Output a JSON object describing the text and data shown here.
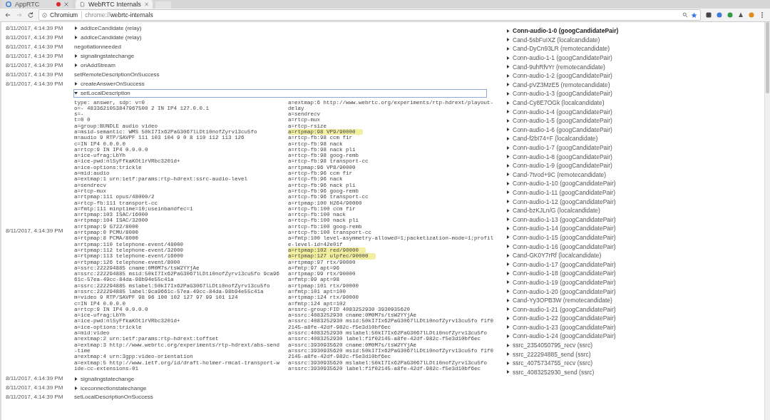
{
  "browser": {
    "tabs": [
      {
        "title": "AppRTC",
        "selected": false,
        "recording": true
      },
      {
        "title": "WebRTC Internals",
        "selected": true,
        "recording": false
      }
    ],
    "address": {
      "chip": "Chromium",
      "url_scheme": "chrome://",
      "url_path": "webrtc-internals"
    }
  },
  "events": [
    {
      "time": "8/11/2017, 4:14:39 PM",
      "kind": "details",
      "label": "addIceCandidate (relay)",
      "expanded": false
    },
    {
      "time": "8/11/2017, 4:14:39 PM",
      "kind": "details",
      "label": "addIceCandidate (relay)",
      "expanded": false
    },
    {
      "time": "8/11/2017, 4:14:39 PM",
      "kind": "plain",
      "label": "negotiationneeded"
    },
    {
      "time": "8/11/2017, 4:14:39 PM",
      "kind": "details",
      "label": "signalingstatechange",
      "expanded": false
    },
    {
      "time": "8/11/2017, 4:14:39 PM",
      "kind": "details",
      "label": "onAddStream",
      "expanded": false
    },
    {
      "time": "8/11/2017, 4:14:39 PM",
      "kind": "plain",
      "label": "setRemoteDescriptionOnSuccess"
    },
    {
      "time": "8/11/2017, 4:14:39 PM",
      "kind": "details",
      "label": "createAnswerOnSuccess",
      "expanded": false
    },
    {
      "time": "8/11/2017, 4:14:39 PM",
      "kind": "details",
      "label": "setLocalDescription",
      "expanded": true,
      "sdp": [
        {
          "text": "type: answer, sdp: v=0",
          "highlighted": false
        },
        {
          "text": "o=- 4833621053847967500 2 IN IP4 127.0.0.1",
          "highlighted": false
        },
        {
          "text": "s=-",
          "highlighted": false
        },
        {
          "text": "t=0 0",
          "highlighted": false
        },
        {
          "text": "a=group:BUNDLE audio video",
          "highlighted": false
        },
        {
          "text": "a=msid-semantic: WMS 50kI7Ix62PaG3067lLDti0nofZyrv13cu5fo",
          "highlighted": false
        },
        {
          "text": "m=audio 9 RTP/SAVPF 111 103 104 9 0 8 110 112 113 126",
          "highlighted": false
        },
        {
          "text": "c=IN IP4 0.0.0.0",
          "highlighted": false
        },
        {
          "text": "a=rtcp:9 IN IP4 0.0.0.0",
          "highlighted": false
        },
        {
          "text": "a=ice-ufrag:LbYh",
          "highlighted": false
        },
        {
          "text": "a=ice-pwd:nl5yFfkaKOt1rVRbc3201d+",
          "highlighted": false
        },
        {
          "text": "a=ice-options:trickle",
          "highlighted": false
        },
        {
          "text": "a=mid:audio",
          "highlighted": false
        },
        {
          "text": "a=extmap:1 urn:ietf:params:rtp-hdrext:ssrc-audio-level",
          "highlighted": false
        },
        {
          "text": "a=sendrecv",
          "highlighted": false
        },
        {
          "text": "a=rtcp-mux",
          "highlighted": false
        },
        {
          "text": "a=rtpmap:111 opus/48000/2",
          "highlighted": false
        },
        {
          "text": "a=rtcp-fb:111 transport-cc",
          "highlighted": false
        },
        {
          "text": "a=fmtp:111 minptime=10;useinbandfec=1",
          "highlighted": false
        },
        {
          "text": "a=rtpmap:103 ISAC/16000",
          "highlighted": false
        },
        {
          "text": "a=rtpmap:104 ISAC/32000",
          "highlighted": false
        },
        {
          "text": "a=rtpmap:9 G722/8000",
          "highlighted": false
        },
        {
          "text": "a=rtpmap:0 PCMU/8000",
          "highlighted": false
        },
        {
          "text": "a=rtpmap:8 PCMA/8000",
          "highlighted": false
        },
        {
          "text": "a=rtpmap:110 telephone-event/48000",
          "highlighted": false
        },
        {
          "text": "a=rtpmap:112 telephone-event/32000",
          "highlighted": false
        },
        {
          "text": "a=rtpmap:113 telephone-event/16000",
          "highlighted": false
        },
        {
          "text": "a=rtpmap:126 telephone-event/8000",
          "highlighted": false
        },
        {
          "text": "a=ssrc:222294885 cname:0M0M7s/tsW2YYjAe",
          "highlighted": false
        },
        {
          "text": "a=ssrc:222294885 msid:50kI7Ix62PaG3067lLDti0nofZyrv13cu5fo 9ca9661c-57ea-49cc-84da-98b94e55c41a",
          "highlighted": false
        },
        {
          "text": "a=ssrc:222294885 mslabel:50kI7Ix62PaG3067lLDti0nofZyrv13cu5fo",
          "highlighted": false
        },
        {
          "text": "a=ssrc:222294885 label:9ca9661c-57ea-49cc-84da-98b94e55c41a",
          "highlighted": false
        },
        {
          "text": "m=video 9 RTP/SAVPF 98 96 100 102 127 97 99 101 124",
          "highlighted": false
        },
        {
          "text": "c=IN IP4 0.0.0.0",
          "highlighted": false
        },
        {
          "text": "a=rtcp:9 IN IP4 0.0.0.0",
          "highlighted": false
        },
        {
          "text": "a=ice-ufrag:LbYh",
          "highlighted": false
        },
        {
          "text": "a=ice-pwd:nl5yFfkaKOt1rVRbc3201d+",
          "highlighted": false
        },
        {
          "text": "a=ice-options:trickle",
          "highlighted": false
        },
        {
          "text": "a=mid:video",
          "highlighted": false
        },
        {
          "text": "a=extmap:2 urn:ietf:params:rtp-hdrext:toffset",
          "highlighted": false
        },
        {
          "text": "a=extmap:3 http://www.webrtc.org/experiments/rtp-hdrext/abs-send-time",
          "highlighted": false
        },
        {
          "text": "a=extmap:4 urn:3gpp:video-orientation",
          "highlighted": false
        },
        {
          "text": "a=extmap:5 http://www.ietf.org/id/draft-holmer-rmcat-transport-wide-cc-extensions-01",
          "highlighted": false
        },
        {
          "text": "a=extmap:6 http://www.webrtc.org/experiments/rtp-hdrext/playout-delay",
          "highlighted": false
        },
        {
          "text": "a=sendrecv",
          "highlighted": false
        },
        {
          "text": "a=rtcp-mux",
          "highlighted": false
        },
        {
          "text": "a=rtcp-rsize",
          "highlighted": false
        },
        {
          "text": "a=rtpmap:98 VP9/90000",
          "highlighted": true
        },
        {
          "text": "a=rtcp-fb:98 ccm fir",
          "highlighted": false
        },
        {
          "text": "a=rtcp-fb:98 nack",
          "highlighted": false
        },
        {
          "text": "a=rtcp-fb:98 nack pli",
          "highlighted": false
        },
        {
          "text": "a=rtcp-fb:98 goog-remb",
          "highlighted": false
        },
        {
          "text": "a=rtcp-fb:98 transport-cc",
          "highlighted": false
        },
        {
          "text": "a=rtpmap:96 VP8/90000",
          "highlighted": false
        },
        {
          "text": "a=rtcp-fb:96 ccm fir",
          "highlighted": false
        },
        {
          "text": "a=rtcp-fb:96 nack",
          "highlighted": false
        },
        {
          "text": "a=rtcp-fb:96 nack pli",
          "highlighted": false
        },
        {
          "text": "a=rtcp-fb:96 goog-remb",
          "highlighted": false
        },
        {
          "text": "a=rtcp-fb:96 transport-cc",
          "highlighted": false
        },
        {
          "text": "a=rtpmap:100 H264/90000",
          "highlighted": false
        },
        {
          "text": "a=rtcp-fb:100 ccm fir",
          "highlighted": false
        },
        {
          "text": "a=rtcp-fb:100 nack",
          "highlighted": false
        },
        {
          "text": "a=rtcp-fb:100 nack pli",
          "highlighted": false
        },
        {
          "text": "a=rtcp-fb:100 goog-remb",
          "highlighted": false
        },
        {
          "text": "a=rtcp-fb:100 transport-cc",
          "highlighted": false
        },
        {
          "text": "a=fmtp:100 level-asymmetry-allowed=1;packetization-mode=1;profile-level-id=42e01f",
          "highlighted": false
        },
        {
          "text": "a=rtpmap:102 red/90000",
          "highlighted": true
        },
        {
          "text": "a=rtpmap:127 ulpfec/90000",
          "highlighted": true
        },
        {
          "text": "a=rtpmap:97 rtx/90000",
          "highlighted": false
        },
        {
          "text": "a=fmtp:97 apt=96",
          "highlighted": false
        },
        {
          "text": "a=rtpmap:99 rtx/90000",
          "highlighted": false
        },
        {
          "text": "a=fmtp:99 apt=98",
          "highlighted": false
        },
        {
          "text": "a=rtpmap:101 rtx/90000",
          "highlighted": false
        },
        {
          "text": "a=fmtp:101 apt=100",
          "highlighted": false
        },
        {
          "text": "a=rtpmap:124 rtx/90000",
          "highlighted": false
        },
        {
          "text": "a=fmtp:124 apt=102",
          "highlighted": false
        },
        {
          "text": "a=ssrc-group:FID 4083252930 3930935620",
          "highlighted": false
        },
        {
          "text": "a=ssrc:4083252930 cname:0M0M7s/tsW2YYjAe",
          "highlighted": false
        },
        {
          "text": "a=ssrc:4083252930 msid:50kI7Ix62PaG3067lLDti0nofZyrv13cu5fo f1f02145-a8fe-42df-982c-f5e3d10bf6ec",
          "highlighted": false
        },
        {
          "text": "a=ssrc:4083252930 mslabel:50kI7Ix62PaG3067lLDti0nofZyrv13cu5fo",
          "highlighted": false
        },
        {
          "text": "a=ssrc:4083252930 label:f1f02145-a8fe-42df-982c-f5e3d10bf6ec",
          "highlighted": false
        },
        {
          "text": "a=ssrc:3930935620 cname:0M0M7s/tsW2YYjAe",
          "highlighted": false
        },
        {
          "text": "a=ssrc:3930935620 msid:50kI7Ix62PaG3067lLDti0nofZyrv13cu5fo f1f02145-a8fe-42df-982c-f5e3d10bf6ec",
          "highlighted": false
        },
        {
          "text": "a=ssrc:3930935620 mslabel:50kI7Ix62PaG3067lLDti0nofZyrv13cu5fo",
          "highlighted": false
        },
        {
          "text": "a=ssrc:3930935620 label:f1f02145-a8fe-42df-982c-f5e3d10bf6ec",
          "highlighted": false
        }
      ]
    },
    {
      "time": "8/11/2017, 4:14:39 PM",
      "kind": "details",
      "label": "signalingstatechange",
      "expanded": false
    },
    {
      "time": "8/11/2017, 4:14:39 PM",
      "kind": "details",
      "label": "iceconnectionstatechange",
      "expanded": false
    },
    {
      "time": "8/11/2017, 4:14:39 PM",
      "kind": "plain",
      "label": "setLocalDescriptionOnSuccess"
    }
  ],
  "stats": [
    {
      "label": "Conn-audio-1-0 (googCandidatePair)",
      "active": true
    },
    {
      "label": "Cand-5sbFuIXZ (localcandidate)",
      "active": false
    },
    {
      "label": "Cand-DyCn93LR (remotecandidate)",
      "active": false
    },
    {
      "label": "Conn-audio-1-1 (googCandidatePair)",
      "active": false
    },
    {
      "label": "Cand-9uhRfvYr (remotecandidate)",
      "active": false
    },
    {
      "label": "Conn-audio-1-2 (googCandidatePair)",
      "active": false
    },
    {
      "label": "Cand-pVZ3MzE5 (remotecandidate)",
      "active": false
    },
    {
      "label": "Conn-audio-1-3 (googCandidatePair)",
      "active": false
    },
    {
      "label": "Cand-Cy8E7OGk (localcandidate)",
      "active": false
    },
    {
      "label": "Conn-audio-1-4 (googCandidatePair)",
      "active": false
    },
    {
      "label": "Conn-audio-1-5 (googCandidatePair)",
      "active": false
    },
    {
      "label": "Conn-audio-1-6 (googCandidatePair)",
      "active": false
    },
    {
      "label": "Cand-f2bI74+F (localcandidate)",
      "active": false
    },
    {
      "label": "Conn-audio-1-7 (googCandidatePair)",
      "active": false
    },
    {
      "label": "Conn-audio-1-8 (googCandidatePair)",
      "active": false
    },
    {
      "label": "Conn-audio-1-9 (googCandidatePair)",
      "active": false
    },
    {
      "label": "Cand-7tvod+9C (remotecandidate)",
      "active": false
    },
    {
      "label": "Conn-audio-1-10 (googCandidatePair)",
      "active": false
    },
    {
      "label": "Conn-audio-1-11 (googCandidatePair)",
      "active": false
    },
    {
      "label": "Conn-audio-1-12 (googCandidatePair)",
      "active": false
    },
    {
      "label": "Cand-bzKJLn/G (localcandidate)",
      "active": false
    },
    {
      "label": "Conn-audio-1-13 (googCandidatePair)",
      "active": false
    },
    {
      "label": "Conn-audio-1-14 (googCandidatePair)",
      "active": false
    },
    {
      "label": "Conn-audio-1-15 (googCandidatePair)",
      "active": false
    },
    {
      "label": "Conn-audio-1-16 (googCandidatePair)",
      "active": false
    },
    {
      "label": "Cand-GK0Y7rRf (localcandidate)",
      "active": false
    },
    {
      "label": "Conn-audio-1-17 (googCandidatePair)",
      "active": false
    },
    {
      "label": "Conn-audio-1-18 (googCandidatePair)",
      "active": false
    },
    {
      "label": "Conn-audio-1-19 (googCandidatePair)",
      "active": false
    },
    {
      "label": "Conn-audio-1-20 (googCandidatePair)",
      "active": false
    },
    {
      "label": "Cand-Yy3OPB3W (remotecandidate)",
      "active": false
    },
    {
      "label": "Conn-audio-1-21 (googCandidatePair)",
      "active": false
    },
    {
      "label": "Conn-audio-1-22 (googCandidatePair)",
      "active": false
    },
    {
      "label": "Conn-audio-1-23 (googCandidatePair)",
      "active": false
    },
    {
      "label": "Conn-audio-1-24 (googCandidatePair)",
      "active": false
    },
    {
      "label": "ssrc_2354050795_recv (ssrc)",
      "active": false
    },
    {
      "label": "ssrc_222294885_send (ssrc)",
      "active": false
    },
    {
      "label": "ssrc_4075734755_recv (ssrc)",
      "active": false
    },
    {
      "label": "ssrc_4083252930_send (ssrc)",
      "active": false
    }
  ]
}
